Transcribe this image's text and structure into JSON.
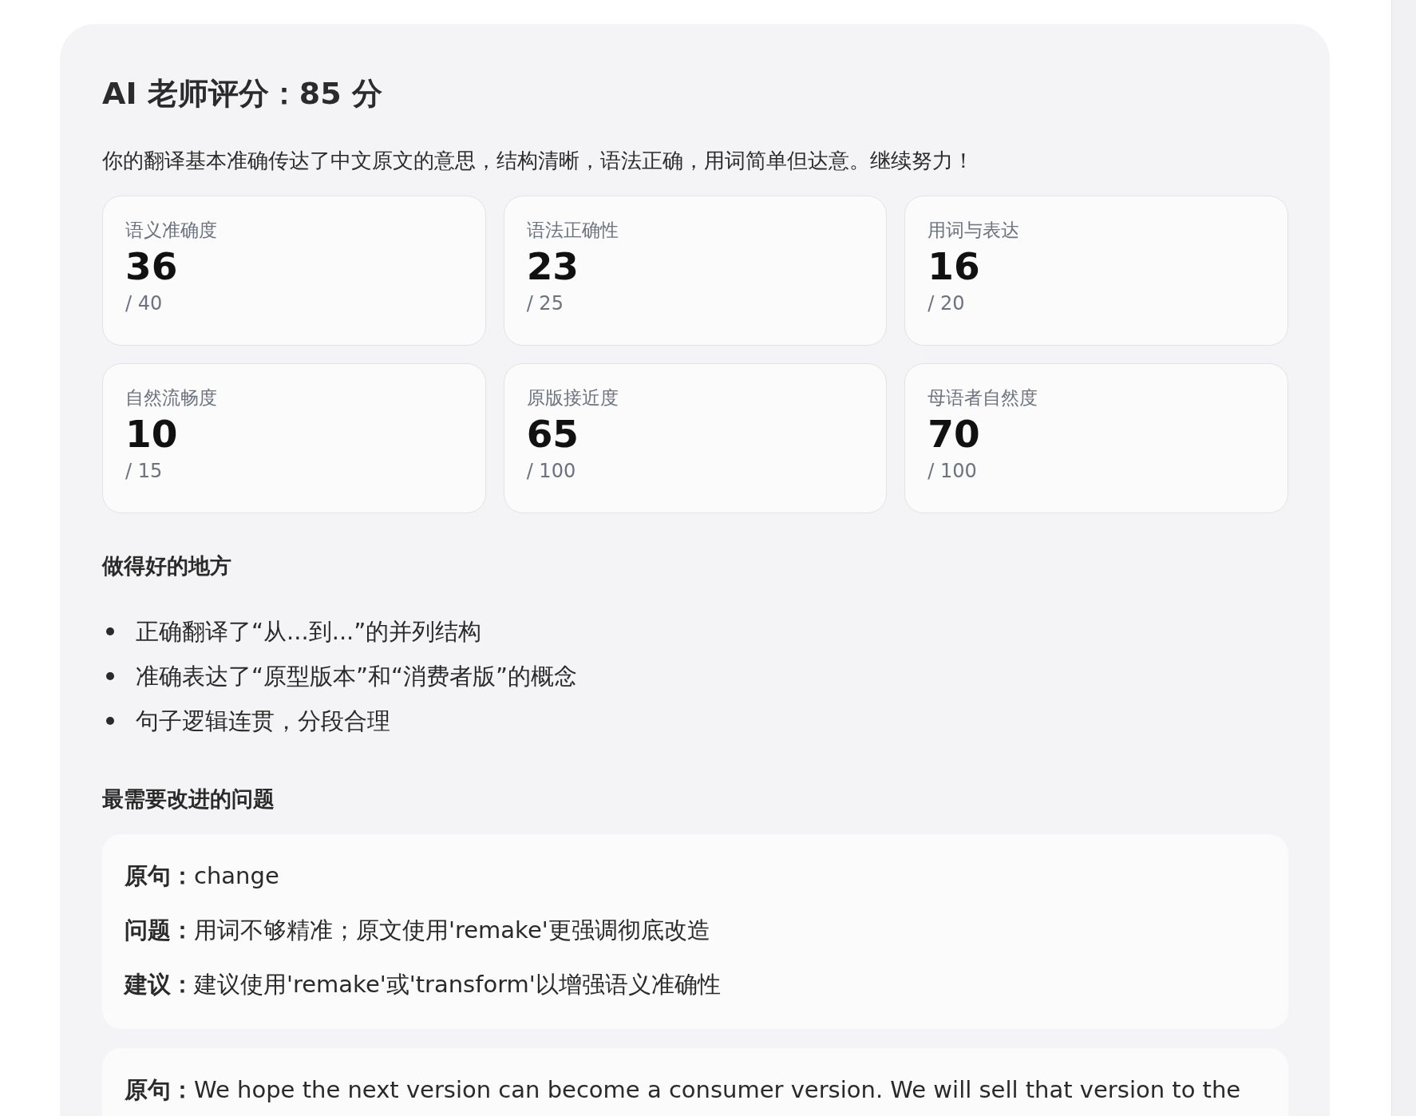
{
  "title": "AI 老师评分：85 分",
  "summary": "你的翻译基本准确传达了中文原文的意思，结构清晰，语法正确，用词简单但达意。继续努力！",
  "scores": [
    {
      "label": "语义准确度",
      "value": "36",
      "max": "/ 40"
    },
    {
      "label": "语法正确性",
      "value": "23",
      "max": "/ 25"
    },
    {
      "label": "用词与表达",
      "value": "16",
      "max": "/ 20"
    },
    {
      "label": "自然流畅度",
      "value": "10",
      "max": "/ 15"
    },
    {
      "label": "原版接近度",
      "value": "65",
      "max": "/ 100"
    },
    {
      "label": "母语者自然度",
      "value": "70",
      "max": "/ 100"
    }
  ],
  "strengths": {
    "heading": "做得好的地方",
    "items": [
      "正确翻译了“从...到...”的并列结构",
      "准确表达了“原型版本”和“消费者版”的概念",
      "句子逻辑连贯，分段合理"
    ]
  },
  "issues": {
    "heading": "最需要改进的问题",
    "cards": [
      {
        "lines": [
          "**原句：**change",
          "**问题：**用词不够精准；原文使用'remake'更强调彻底改造",
          "**建议：**建议使用'remake'或'transform'以增强语义准确性"
        ]
      },
      {
        "lines": [
          "**原句：**We hope the next version can become a consumer version. We will sell that version to the"
        ]
      }
    ]
  }
}
